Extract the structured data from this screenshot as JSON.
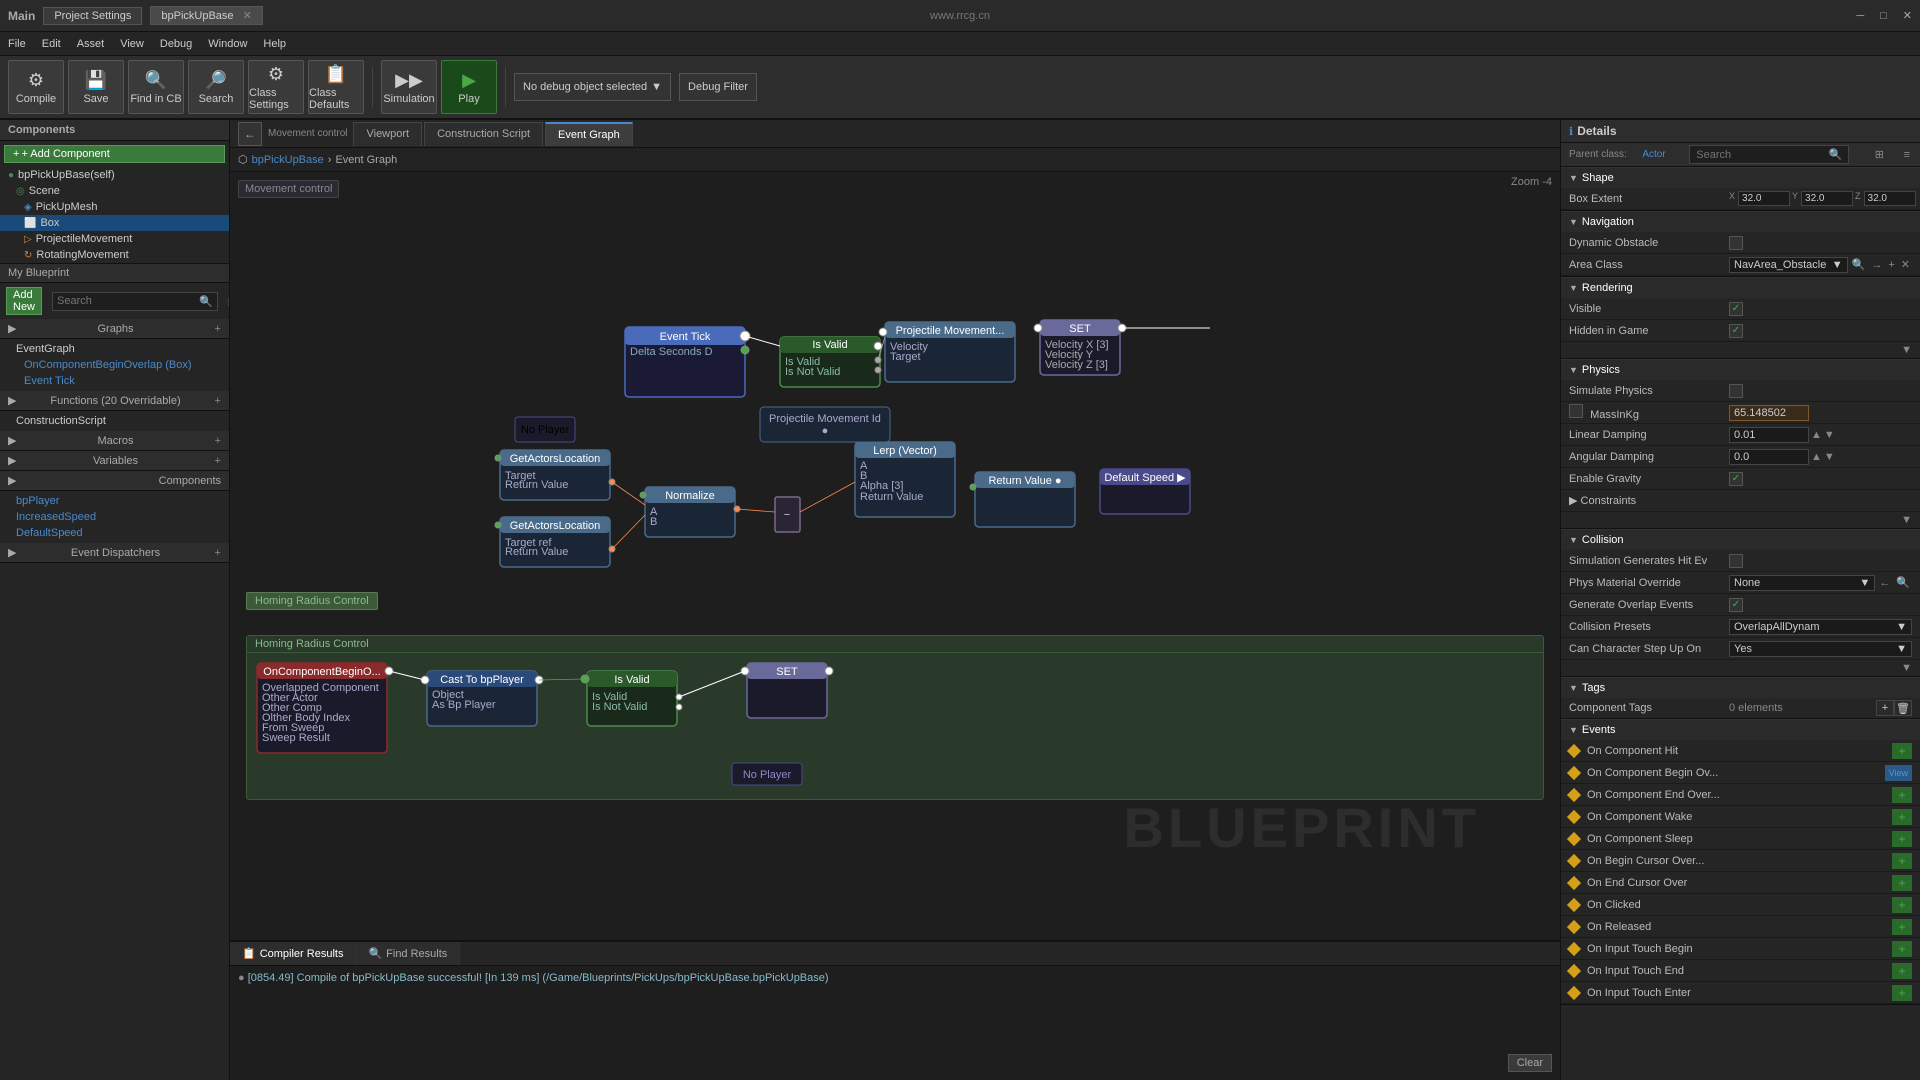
{
  "window": {
    "title": "Main",
    "tab1": "Project Settings",
    "tab2": "bpPickUpBase",
    "url": "www.rrcg.cn"
  },
  "menu": {
    "items": [
      "File",
      "Edit",
      "Asset",
      "View",
      "Debug",
      "Window",
      "Help"
    ]
  },
  "toolbar": {
    "compile": "Compile",
    "save": "Save",
    "find_in_cb": "Find in CB",
    "search": "Search",
    "class_settings": "Class Settings",
    "class_defaults": "Class Defaults",
    "simulation": "Simulation",
    "play": "Play",
    "debug_label": "No debug object selected",
    "debug_filter": "Debug Filter"
  },
  "left_panel": {
    "components_label": "+ Add Component",
    "self_label": "bpPickUpBase(self)",
    "scene_label": "Scene",
    "pickup_mesh": "PickUpMesh",
    "box_label": "Box",
    "projectile_label": "ProjectileMovement",
    "rotating_label": "RotatingMovement",
    "my_blueprint": "My Blueprint",
    "add_new": "Add New",
    "search_placeholder": "Search",
    "graphs": "Graphs",
    "event_graph": "EventGraph",
    "on_component": "OnComponentBeginOverlap (Box)",
    "event_tick": "Event Tick",
    "functions": "Functions (20 Overridable)",
    "construction_script": "ConstructionScript",
    "macros": "Macros",
    "variables": "Variables",
    "components": "Components",
    "bp_player": "bpPlayer",
    "increased_speed": "IncreasedSpeed",
    "default_speed": "DefaultSpeed",
    "event_dispatchers": "Event Dispatchers"
  },
  "tabs": {
    "viewport": "Viewport",
    "construction_script": "Construction Script",
    "event_graph": "Event Graph"
  },
  "breadcrumb": {
    "icon": "⬡",
    "blueprint": "bpPickUpBase",
    "separator": "›",
    "graph": "Event Graph"
  },
  "graph": {
    "zoom": "Zoom -4",
    "movement_control": "Movement control",
    "homing_radius": "Homing Radius Control",
    "homing_header": "Homing Radius Control"
  },
  "bottom": {
    "compiler_tab": "Compiler Results",
    "find_tab": "Find Results",
    "compile_msg": "[0854.49] Compile of bpPickUpBase successful! [In 139 ms] (/Game/Blueprints/PickUps/bpPickUpBase.bpPickUpBase)",
    "clear": "Clear"
  },
  "right_panel": {
    "details_label": "Details",
    "search_placeholder": "Search",
    "parent_class": "Parent class: Actor",
    "shape": {
      "label": "Shape",
      "box_extent_label": "Box Extent",
      "x": "32.0",
      "y": "32.0",
      "z": "32.0"
    },
    "navigation": {
      "label": "Navigation",
      "dynamic_obstacle": "Dynamic Obstacle",
      "area_class": "Area Class",
      "area_class_value": "NavArea_Obstacle"
    },
    "rendering": {
      "label": "Rendering",
      "visible": "Visible",
      "hidden_in_game": "Hidden in Game"
    },
    "physics": {
      "label": "Physics",
      "simulate_physics": "Simulate Physics",
      "mass_kg": "MassInKg",
      "mass_value": "65.148502",
      "linear_damping": "Linear Damping",
      "linear_value": "0.01",
      "angular_damping": "Angular Damping",
      "angular_value": "0.0",
      "enable_gravity": "Enable Gravity"
    },
    "collision": {
      "label": "Collision",
      "sim_generates": "Simulation Generates Hit Ev",
      "phys_material": "Phys Material Override",
      "phys_value": "None",
      "generate_overlap": "Generate Overlap Events",
      "collision_presets": "Collision Presets",
      "collision_value": "OverlapAllDynam",
      "can_char_step": "Can Character Step Up On",
      "step_value": "Yes"
    },
    "tags": {
      "label": "Tags",
      "component_tags": "Component Tags",
      "elements": "0 elements"
    },
    "events": {
      "label": "Events",
      "on_component_hit": "On Component Hit",
      "on_component_begin": "On Component Begin Ov...",
      "on_component_end": "On Component End Over...",
      "on_component_wake": "On Component Wake",
      "on_component_sleep": "On Component Sleep",
      "on_begin_cursor": "On Begin Cursor Over...",
      "on_end_cursor": "On End Cursor Over",
      "on_clicked": "On Clicked",
      "on_released": "On Released",
      "on_input_touch_begin": "On Input Touch Begin",
      "on_input_touch_end": "On Input Touch End",
      "on_input_touch_enter": "On Input Touch Enter"
    }
  }
}
